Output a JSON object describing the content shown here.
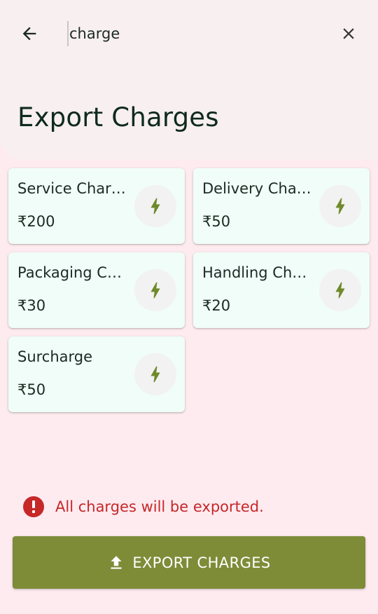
{
  "search": {
    "value": "charge",
    "placeholder": ""
  },
  "page_title": "Export Charges",
  "charges": [
    {
      "name": "Service Char…",
      "amount": "₹200"
    },
    {
      "name": "Delivery Cha…",
      "amount": "₹50"
    },
    {
      "name": "Packaging C…",
      "amount": "₹30"
    },
    {
      "name": "Handling Ch…",
      "amount": "₹20"
    },
    {
      "name": "Surcharge",
      "amount": "₹50"
    }
  ],
  "notice": {
    "text": "All charges will be exported.",
    "icon": "info-icon"
  },
  "export_button": {
    "label": "EXPORT CHARGES",
    "icon": "upload-icon"
  },
  "colors": {
    "background": "#fdebf0",
    "header": "#f8eff1",
    "card": "#f0fdf8",
    "accent": "#7e8c38",
    "bolt": "#6e8a2a",
    "error": "#c62828"
  }
}
